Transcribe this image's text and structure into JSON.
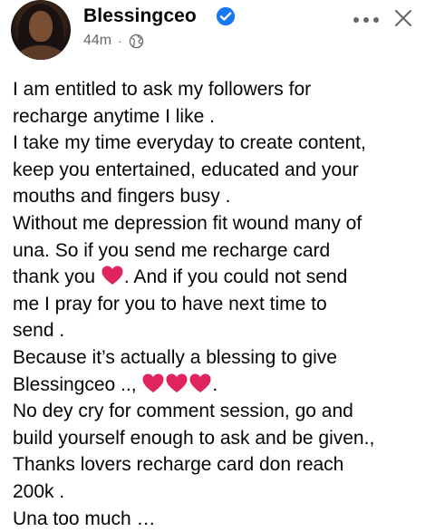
{
  "post": {
    "author": "Blessingceo",
    "time": "44m",
    "separator": "·",
    "privacy_icon": "globe-icon",
    "verified_icon": "verified-badge-icon",
    "body_lines": [
      "I am entitled to ask my followers for",
      "recharge anytime I like .",
      "I take my time everyday to create content,",
      "keep you entertained, educated and your",
      "mouths and fingers busy .",
      "Without me depression fit wound many of",
      "una. So if you send me recharge card",
      "thank you",
      ". And if you could not send",
      "me I pray for you to have next time to",
      "send .",
      "Because it’s actually a blessing to give",
      "Blessingceo ..,",
      ".",
      "No dey cry for comment session, go and",
      "build yourself enough to ask and be given.,",
      "Thanks lovers recharge card don reach",
      "200k .",
      "Una too much …"
    ]
  },
  "colors": {
    "verified": "#1877f2",
    "heart": "#e0245e",
    "muted": "#65676b"
  }
}
